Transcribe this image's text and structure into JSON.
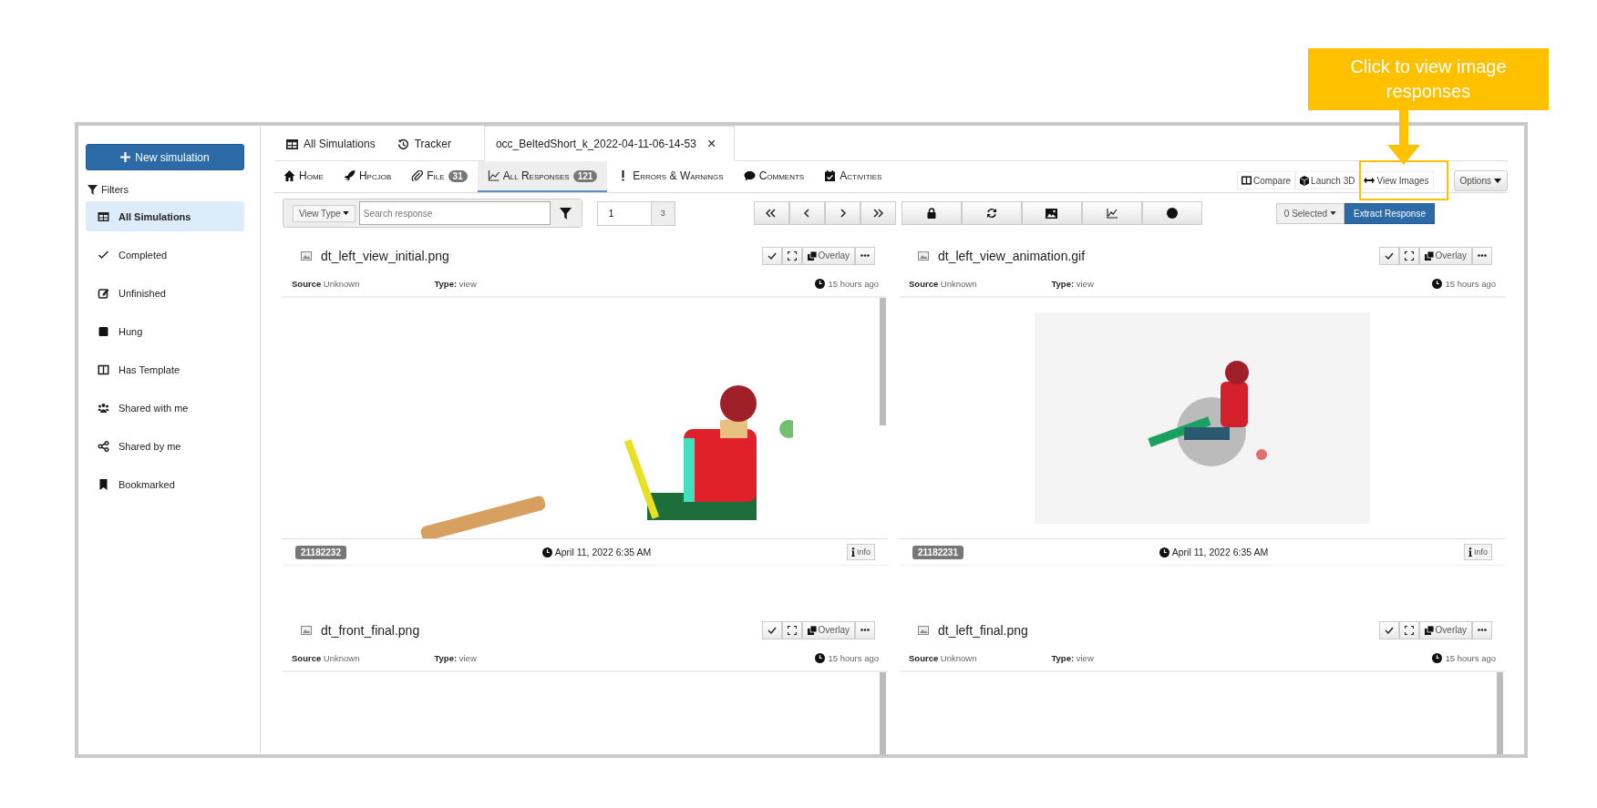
{
  "callout": {
    "text": "Click to view image responses"
  },
  "sidebar": {
    "new_button": "New simulation",
    "filters_label": "Filters",
    "items": [
      {
        "label": "All Simulations",
        "kind": "grid",
        "selected": true
      },
      {
        "label": "Completed",
        "kind": "check",
        "selected": false
      },
      {
        "label": "Unfinished",
        "kind": "edit",
        "selected": false
      },
      {
        "label": "Hung",
        "kind": "square",
        "selected": false
      },
      {
        "label": "Has Template",
        "kind": "columns",
        "selected": false
      },
      {
        "label": "Shared with me",
        "kind": "users",
        "selected": false
      },
      {
        "label": "Shared by me",
        "kind": "share",
        "selected": false
      },
      {
        "label": "Bookmarked",
        "kind": "bookmark",
        "selected": false
      }
    ]
  },
  "top_tabs": [
    {
      "label": "All Simulations",
      "kind": "grid",
      "selected": false
    },
    {
      "label": "Tracker",
      "kind": "history",
      "selected": false
    },
    {
      "label": "occ_BeltedShort_k_2022-04-11-06-14-53",
      "kind": "file",
      "selected": true,
      "close": "×"
    }
  ],
  "subnav": {
    "tabs": [
      {
        "label": "Home",
        "kind": "home",
        "selected": false
      },
      {
        "label": "Hpcjob",
        "kind": "rocket",
        "selected": false
      },
      {
        "label": "File",
        "kind": "clip",
        "badge": "31",
        "selected": false
      },
      {
        "label": "All Responses",
        "kind": "chart",
        "badge": "121",
        "selected": true
      },
      {
        "label": "Errors & Warnings",
        "kind": "bang",
        "selected": false
      },
      {
        "label": "Comments",
        "kind": "comment",
        "selected": false
      },
      {
        "label": "Activities",
        "kind": "calendar",
        "selected": false
      }
    ],
    "actions": [
      {
        "label": "Compare",
        "kind": "columns",
        "highlighted": false
      },
      {
        "label": "Launch 3D",
        "kind": "cube",
        "highlighted": false
      },
      {
        "label": "View Images",
        "kind": "arrows",
        "highlighted": true
      }
    ],
    "options": "Options"
  },
  "toolbar": {
    "view_type": "View Type",
    "search_placeholder": "Search response",
    "page": "1",
    "page_total": "3",
    "selected": "0 Selected",
    "extract": "Extract Response"
  },
  "cards": [
    {
      "title": "dt_left_view_initial.png",
      "source_label": "Source",
      "source": "Unknown",
      "type_label": "Type:",
      "type": "view",
      "time": "15 hours ago",
      "overlay": "Overlay",
      "kind": "plain",
      "id": "21182232",
      "date": "April 11, 2022 6:35 AM",
      "info": "Info"
    },
    {
      "title": "dt_left_view_animation.gif",
      "source_label": "Source",
      "source": "Unknown",
      "type_label": "Type:",
      "type": "view",
      "time": "15 hours ago",
      "overlay": "Overlay",
      "kind": "framed",
      "id": "21182231",
      "date": "April 11, 2022 6:35 AM",
      "info": "Info"
    },
    {
      "title": "dt_front_final.png",
      "source_label": "Source",
      "source": "Unknown",
      "type_label": "Type:",
      "type": "view",
      "time": "15 hours ago",
      "overlay": "Overlay",
      "kind": "plain"
    },
    {
      "title": "dt_left_final.png",
      "source_label": "Source",
      "source": "Unknown",
      "type_label": "Type:",
      "type": "view",
      "time": "15 hours ago",
      "overlay": "Overlay",
      "kind": "plain"
    }
  ]
}
